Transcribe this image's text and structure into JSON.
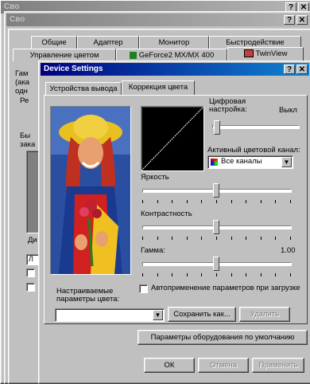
{
  "back_window_1": {
    "title": "Сво"
  },
  "back_window_2": {
    "title": "Сво"
  },
  "props_window": {
    "tabs_row1": [
      "Общие",
      "Адаптер",
      "Монитор",
      "Быстродействие"
    ],
    "tabs_row2": [
      "Управление цветом",
      "GeForce2 MX/MX 400",
      "TwinView"
    ],
    "partial_text": [
      "Гам",
      "(ака",
      "одн",
      "Ре",
      "Бы",
      "зака",
      "Ди",
      "Л"
    ]
  },
  "dialog": {
    "title": "Device Settings",
    "tabs": [
      "Устройства вывода",
      "Коррекция цвета"
    ],
    "fine_tuning_label": "Цифровая настройка:",
    "fine_tuning_value": "Выкл",
    "active_channel_label": "Активный цветовой канал:",
    "active_channel_value": "Все каналы",
    "brightness_label": "Яркость",
    "brightness_level": 0.5,
    "contrast_label": "Контрастность",
    "contrast_level": 0.5,
    "gamma_label": "Гамма:",
    "gamma_value": "1.00",
    "gamma_level": 0.5,
    "auto_apply_label": "Автоприменение параметров при загрузке",
    "custom_params_label": "Настраиваемые параметры цвета:",
    "save_as_button": "Сохранить как...",
    "delete_button": "Удалить",
    "defaults_button": "Параметры оборудования по умолчанию",
    "ok_button": "ОК",
    "cancel_button": "Отмена",
    "apply_button": "Применить"
  }
}
